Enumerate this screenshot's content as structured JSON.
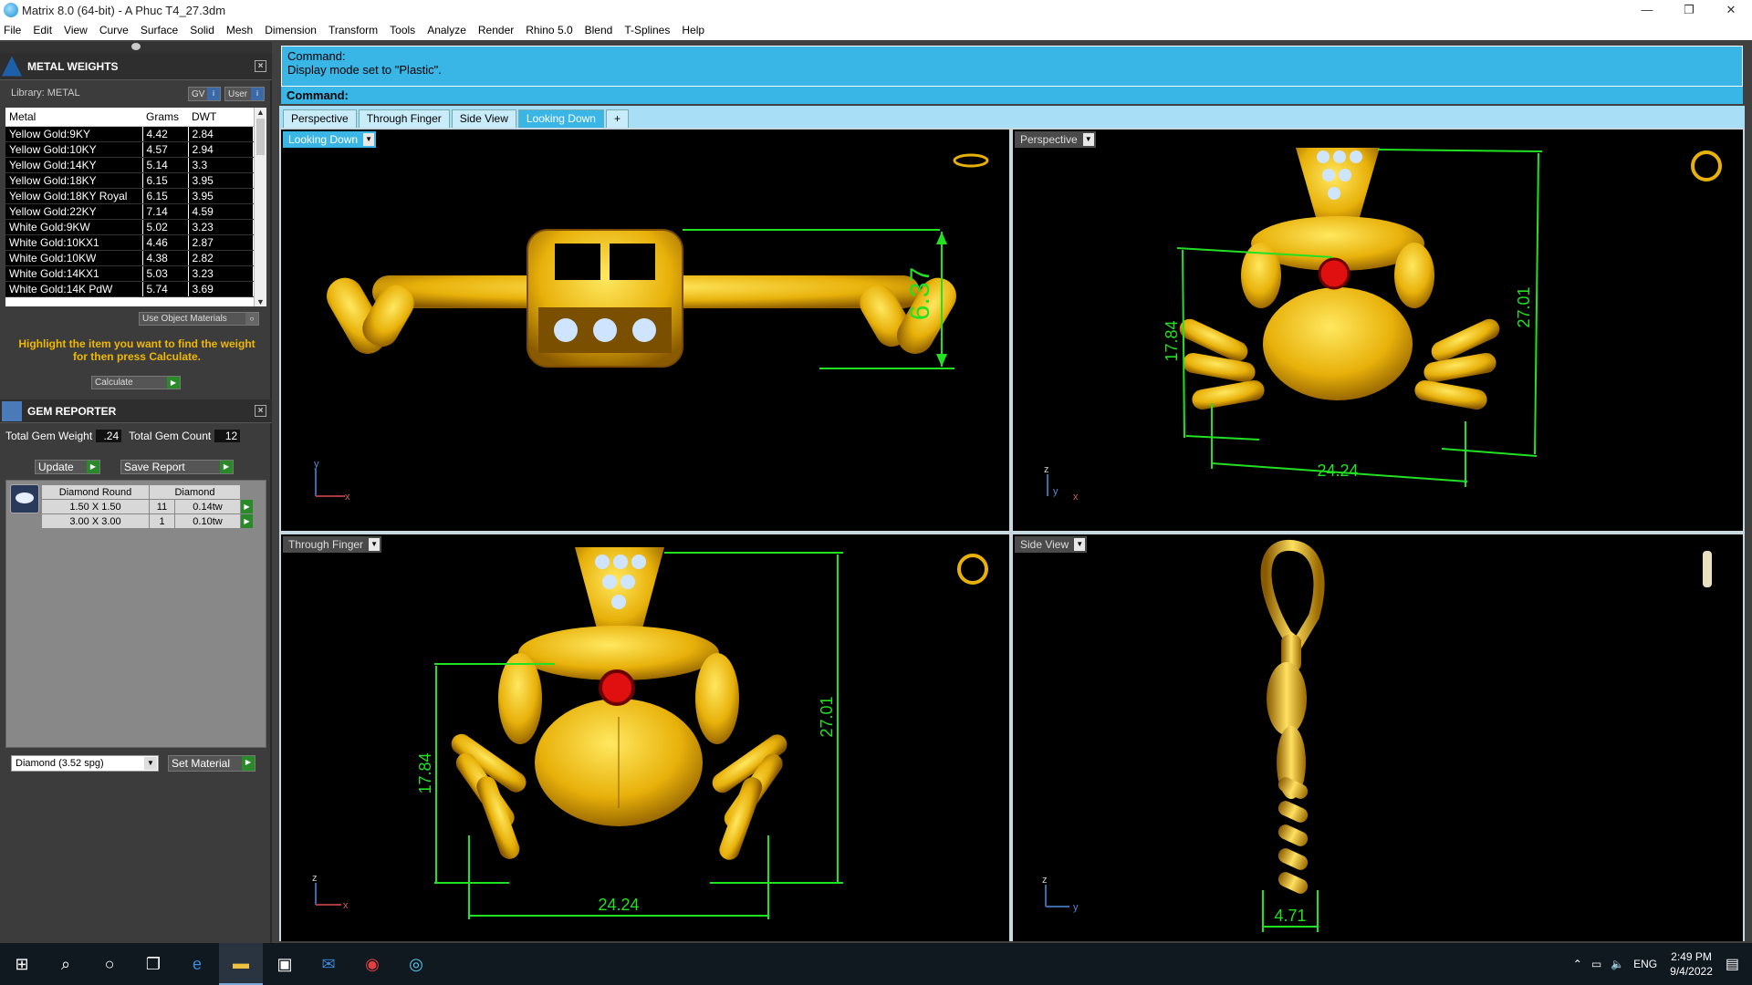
{
  "window": {
    "title": "Matrix 8.0 (64-bit) - A Phuc T4_27.3dm",
    "min": "—",
    "max": "❐",
    "close": "✕"
  },
  "menu": [
    "File",
    "Edit",
    "View",
    "Curve",
    "Surface",
    "Solid",
    "Mesh",
    "Dimension",
    "Transform",
    "Tools",
    "Analyze",
    "Render",
    "Rhino 5.0",
    "Blend",
    "T-Splines",
    "Help"
  ],
  "metal": {
    "title": "METAL WEIGHTS",
    "library": "Library: METAL",
    "gv": "GV",
    "user": "User",
    "headers": [
      "Metal",
      "Grams",
      "DWT"
    ],
    "rows": [
      [
        "Yellow Gold:9KY",
        "4.42",
        "2.84"
      ],
      [
        "Yellow Gold:10KY",
        "4.57",
        "2.94"
      ],
      [
        "Yellow Gold:14KY",
        "5.14",
        "3.3"
      ],
      [
        "Yellow Gold:18KY",
        "6.15",
        "3.95"
      ],
      [
        "Yellow Gold:18KY Royal",
        "6.15",
        "3.95"
      ],
      [
        "Yellow Gold:22KY",
        "7.14",
        "4.59"
      ],
      [
        "White Gold:9KW",
        "5.02",
        "3.23"
      ],
      [
        "White Gold:10KX1",
        "4.46",
        "2.87"
      ],
      [
        "White Gold:10KW",
        "4.38",
        "2.82"
      ],
      [
        "White Gold:14KX1",
        "5.03",
        "3.23"
      ],
      [
        "White Gold:14K PdW",
        "5.74",
        "3.69"
      ]
    ],
    "use_object": "Use Object Materials",
    "hint": "Highlight the item you want to find the weight for then press Calculate.",
    "calculate": "Calculate"
  },
  "gem": {
    "title": "GEM REPORTER",
    "total_weight_label": "Total Gem Weight",
    "total_weight": ".24",
    "total_count_label": "Total Gem Count",
    "total_count": "12",
    "update": "Update",
    "save": "Save Report",
    "headers": [
      "Diamond Round",
      "Diamond"
    ],
    "rows": [
      [
        "1.50 X 1.50",
        "11",
        "0.14tw"
      ],
      [
        "3.00 X 3.00",
        "1",
        "0.10tw"
      ]
    ],
    "material": "Diamond    (3.52 spg)",
    "set_material": "Set Material"
  },
  "command": {
    "history1": "Command:",
    "history2": "Display mode set to \"Plastic\".",
    "prompt": "Command:"
  },
  "tabs": [
    "Perspective",
    "Through Finger",
    "Side View",
    "Looking Down",
    "+"
  ],
  "active_tab": "Looking Down",
  "viewports": {
    "looking_down": {
      "label": "Looking Down",
      "dim": "6.37",
      "ax1": "y",
      "ax2": "x"
    },
    "perspective": {
      "label": "Perspective",
      "dim_a": "17.84",
      "dim_b": "27.01",
      "dim_c": "24.24",
      "ax1": "z",
      "ax2": "y",
      "ax3": "x"
    },
    "through_finger": {
      "label": "Through Finger",
      "dim_a": "17.84",
      "dim_b": "27.01",
      "dim_c": "24.24",
      "ax1": "z",
      "ax2": "x"
    },
    "side_view": {
      "label": "Side View",
      "dim": "4.71",
      "ax1": "z",
      "ax2": "y"
    }
  },
  "colors": {
    "gold": "#e8b10a",
    "gold_dark": "#9c6a00",
    "dim_green": "#22e022",
    "ruby": "#e01010",
    "accent": "#3ab6e6"
  },
  "taskbar": {
    "lang": "ENG",
    "time": "2:49 PM",
    "date": "9/4/2022",
    "notif": "1"
  }
}
